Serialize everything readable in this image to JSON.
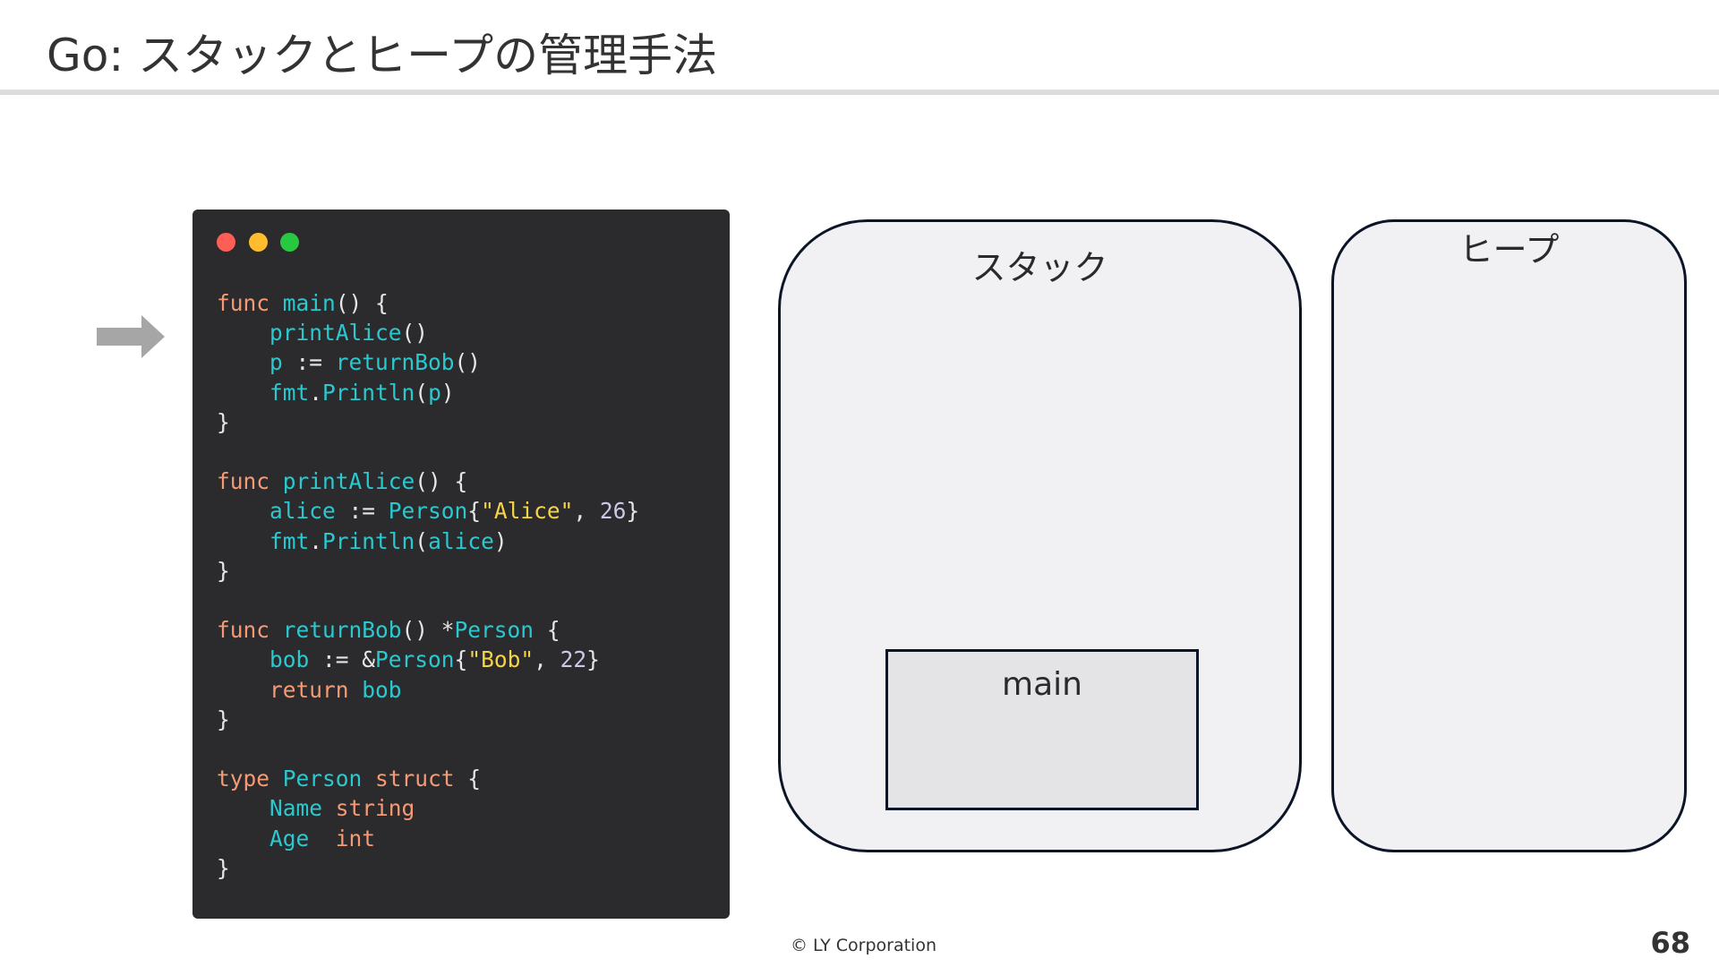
{
  "slide": {
    "title": "Go: スタックとヒープの管理手法",
    "page_number": "68",
    "footer": "© LY Corporation"
  },
  "code_window": {
    "lines": [
      [
        {
          "t": "func ",
          "c": "kw"
        },
        {
          "t": "main",
          "c": "id"
        },
        {
          "t": "() {",
          "c": "pun"
        }
      ],
      [
        {
          "t": "    printAlice",
          "c": "id"
        },
        {
          "t": "()",
          "c": "pun"
        }
      ],
      [
        {
          "t": "    p ",
          "c": "id"
        },
        {
          "t": ":= ",
          "c": "pun"
        },
        {
          "t": "returnBob",
          "c": "id"
        },
        {
          "t": "()",
          "c": "pun"
        }
      ],
      [
        {
          "t": "    fmt",
          "c": "id"
        },
        {
          "t": ".",
          "c": "pun"
        },
        {
          "t": "Println",
          "c": "id"
        },
        {
          "t": "(",
          "c": "pun"
        },
        {
          "t": "p",
          "c": "id"
        },
        {
          "t": ")",
          "c": "pun"
        }
      ],
      [
        {
          "t": "}",
          "c": "pun"
        }
      ],
      [],
      [
        {
          "t": "func ",
          "c": "kw"
        },
        {
          "t": "printAlice",
          "c": "id"
        },
        {
          "t": "() {",
          "c": "pun"
        }
      ],
      [
        {
          "t": "    alice ",
          "c": "id"
        },
        {
          "t": ":= ",
          "c": "pun"
        },
        {
          "t": "Person",
          "c": "id"
        },
        {
          "t": "{",
          "c": "pun"
        },
        {
          "t": "\"Alice\"",
          "c": "str"
        },
        {
          "t": ", ",
          "c": "pun"
        },
        {
          "t": "26",
          "c": "num"
        },
        {
          "t": "}",
          "c": "pun"
        }
      ],
      [
        {
          "t": "    fmt",
          "c": "id"
        },
        {
          "t": ".",
          "c": "pun"
        },
        {
          "t": "Println",
          "c": "id"
        },
        {
          "t": "(",
          "c": "pun"
        },
        {
          "t": "alice",
          "c": "id"
        },
        {
          "t": ")",
          "c": "pun"
        }
      ],
      [
        {
          "t": "}",
          "c": "pun"
        }
      ],
      [],
      [
        {
          "t": "func ",
          "c": "kw"
        },
        {
          "t": "returnBob",
          "c": "id"
        },
        {
          "t": "() *",
          "c": "pun"
        },
        {
          "t": "Person",
          "c": "id"
        },
        {
          "t": " {",
          "c": "pun"
        }
      ],
      [
        {
          "t": "    bob ",
          "c": "id"
        },
        {
          "t": ":= &",
          "c": "pun"
        },
        {
          "t": "Person",
          "c": "id"
        },
        {
          "t": "{",
          "c": "pun"
        },
        {
          "t": "\"Bob\"",
          "c": "str"
        },
        {
          "t": ", ",
          "c": "pun"
        },
        {
          "t": "22",
          "c": "num"
        },
        {
          "t": "}",
          "c": "pun"
        }
      ],
      [
        {
          "t": "    return ",
          "c": "kw"
        },
        {
          "t": "bob",
          "c": "id"
        }
      ],
      [
        {
          "t": "}",
          "c": "pun"
        }
      ],
      [],
      [
        {
          "t": "type ",
          "c": "kw"
        },
        {
          "t": "Person ",
          "c": "id"
        },
        {
          "t": "struct ",
          "c": "kw"
        },
        {
          "t": "{",
          "c": "pun"
        }
      ],
      [
        {
          "t": "    Name ",
          "c": "id"
        },
        {
          "t": "string",
          "c": "kw"
        }
      ],
      [
        {
          "t": "    Age  ",
          "c": "id"
        },
        {
          "t": "int",
          "c": "kw"
        }
      ],
      [
        {
          "t": "}",
          "c": "pun"
        }
      ]
    ]
  },
  "diagram": {
    "stack_label": "スタック",
    "heap_label": "ヒープ",
    "frames": [
      {
        "label": "main"
      }
    ]
  },
  "colors": {
    "code_bg": "#2b2b2d",
    "keyword": "#f59a74",
    "identifier": "#2bc9cf",
    "string": "#f5d547",
    "number": "#cfc6e8",
    "box_fill": "#f1f1f3",
    "box_border": "#0c1528",
    "arrow": "#a6a6a6"
  },
  "icons": {
    "arrow": "right-arrow-icon",
    "window_controls": [
      "close-dot-icon",
      "minimize-dot-icon",
      "maximize-dot-icon"
    ]
  }
}
